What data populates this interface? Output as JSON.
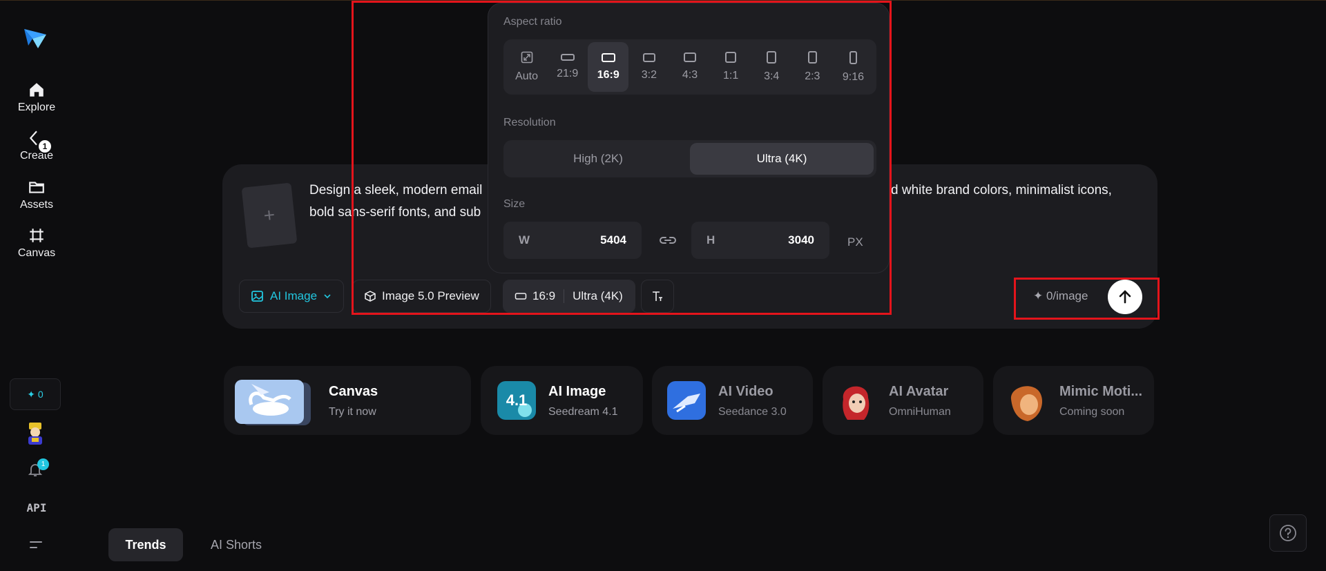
{
  "sidebar": {
    "explore": "Explore",
    "create": "Create",
    "create_badge": "1",
    "assets": "Assets",
    "canvas": "Canvas",
    "credits": "✦ 0",
    "notif_badge": "1",
    "api": "API"
  },
  "composer": {
    "upload_plus": "+",
    "prompt_left": "Design a sleek, modern email",
    "prompt_right_1": "d white brand colors, minimalist icons,",
    "prompt_left_2": "bold sans-serif fonts, and sub",
    "type_chip": "AI Image",
    "model_chip": "Image 5.0 Preview",
    "ratio_chip": "16:9",
    "res_chip": "Ultra (4K)",
    "cost": "✦ 0/image"
  },
  "panel": {
    "aspect_label": "Aspect ratio",
    "ratios": [
      "Auto",
      "21:9",
      "16:9",
      "3:2",
      "4:3",
      "1:1",
      "3:4",
      "2:3",
      "9:16"
    ],
    "selected_ratio": "16:9",
    "resolution_label": "Resolution",
    "res_high": "High (2K)",
    "res_ultra": "Ultra (4K)",
    "size_label": "Size",
    "w_label": "W",
    "w_value": "5404",
    "h_label": "H",
    "h_value": "3040",
    "unit": "PX"
  },
  "cards": [
    {
      "title": "Canvas",
      "subtitle": "Try it now"
    },
    {
      "title": "AI Image",
      "subtitle": "Seedream 4.1",
      "badge": "4.1"
    },
    {
      "title": "AI Video",
      "subtitle": "Seedance 3.0"
    },
    {
      "title": "AI Avatar",
      "subtitle": "OmniHuman"
    },
    {
      "title": "Mimic Moti...",
      "subtitle": "Coming soon"
    }
  ],
  "tabs": {
    "trends": "Trends",
    "shorts": "AI Shorts"
  },
  "colors": {
    "accent": "#22c7e0",
    "annotation": "#e4141b",
    "background": "#0d0d0f"
  }
}
